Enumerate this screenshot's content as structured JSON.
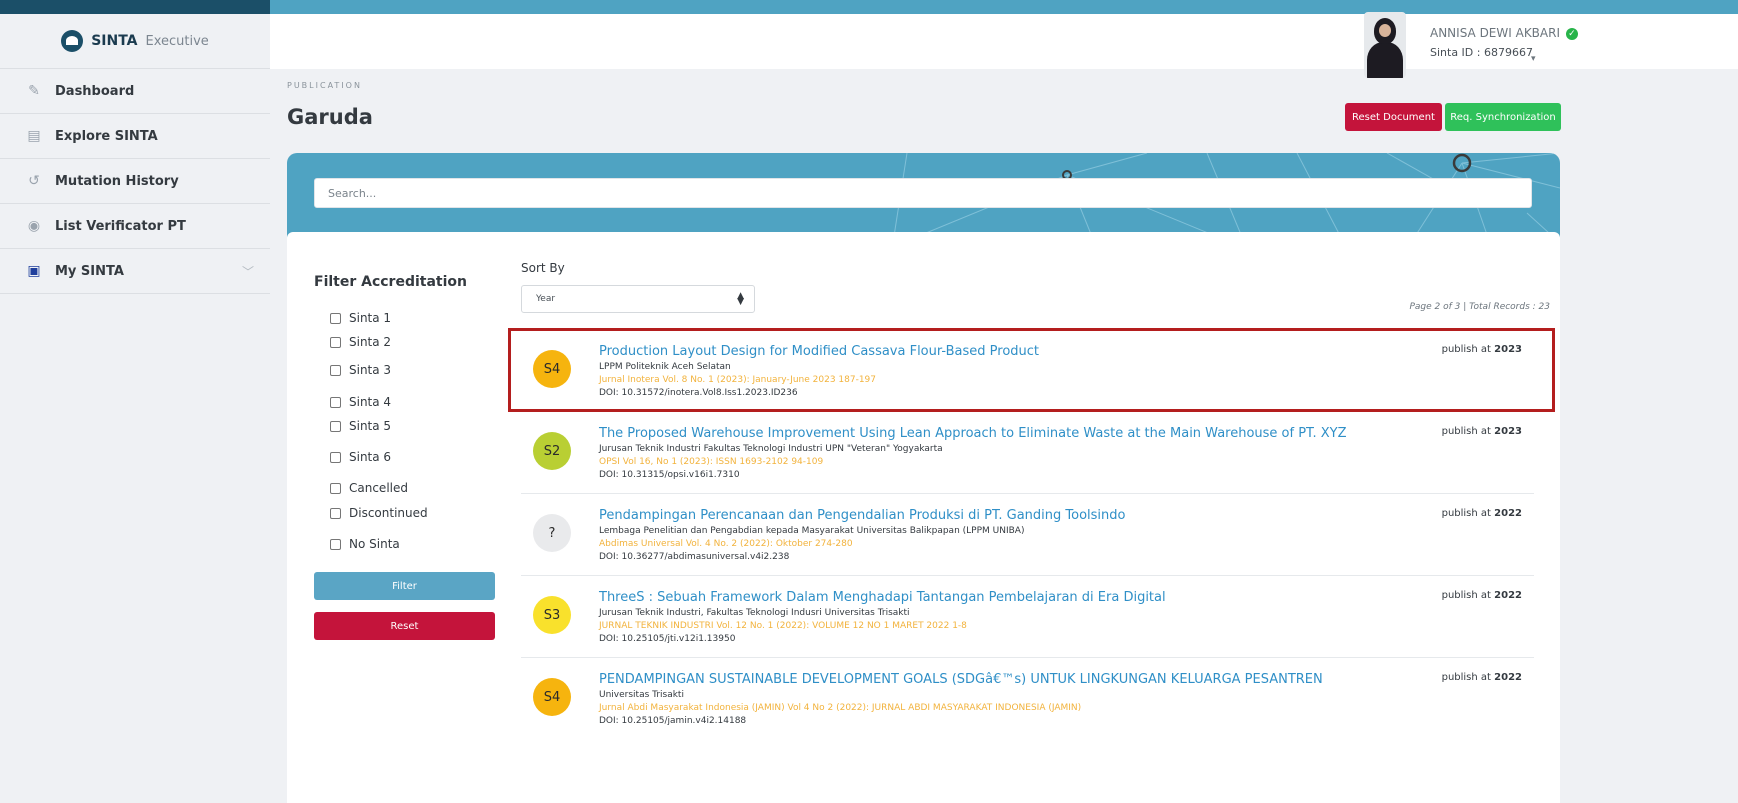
{
  "brand": {
    "name": "SINTA",
    "sub": "Executive"
  },
  "sidebar": {
    "items": [
      {
        "label": "Dashboard",
        "icon": "pencil-icon"
      },
      {
        "label": "Explore SINTA",
        "icon": "document-icon"
      },
      {
        "label": "Mutation History",
        "icon": "history-icon"
      },
      {
        "label": "List Verificator PT",
        "icon": "user-circle-icon"
      },
      {
        "label": "My SINTA",
        "icon": "id-card-icon"
      }
    ]
  },
  "user": {
    "name": "ANNISA DEWI AKBARI",
    "sinta_id": "Sinta ID : 6879667"
  },
  "page": {
    "section": "PUBLICATION",
    "title": "Garuda",
    "reset_document": "Reset Document",
    "req_sync": "Req. Synchronization"
  },
  "search": {
    "placeholder": "Search..."
  },
  "filter": {
    "title": "Filter Accreditation",
    "options": [
      "Sinta 1",
      "Sinta 2",
      "Sinta 3",
      "Sinta 4",
      "Sinta 5",
      "Sinta 6",
      "Cancelled",
      "Discontinued",
      "No Sinta"
    ],
    "filter_label": "Filter",
    "reset_label": "Reset"
  },
  "sort": {
    "label": "Sort By",
    "value": "Year"
  },
  "page_info": "Page 2 of 3 | Total Records : 23",
  "publications": [
    {
      "badge": "S4",
      "badge_color": "#f6b40e",
      "title": "Production Layout Design for Modified Cassava Flour-Based Product",
      "institution": "LPPM Politeknik Aceh Selatan",
      "journal": "Jurnal Inotera Vol. 8 No. 1 (2023): January-June 2023 187-197",
      "doi": "DOI: 10.31572/inotera.Vol8.Iss1.2023.ID236",
      "publish_prefix": "publish at",
      "year": "2023"
    },
    {
      "badge": "S2",
      "badge_color": "#b9cf33",
      "title": "The Proposed Warehouse Improvement Using Lean Approach to Eliminate Waste at the Main Warehouse of PT. XYZ",
      "institution": "Jurusan Teknik Industri Fakultas Teknologi Industri UPN \"Veteran\" Yogyakarta",
      "journal": "OPSI Vol 16, No 1 (2023): ISSN 1693-2102 94-109",
      "doi": "DOI: 10.31315/opsi.v16i1.7310",
      "publish_prefix": "publish at",
      "year": "2023"
    },
    {
      "badge": "?",
      "badge_color": "#e9eaec",
      "title": "Pendampingan Perencanaan dan Pengendalian Produksi di PT. Ganding Toolsindo",
      "institution": "Lembaga Penelitian dan Pengabdian kepada Masyarakat Universitas Balikpapan (LPPM UNIBA)",
      "journal": "Abdimas Universal Vol. 4 No. 2 (2022): Oktober 274-280",
      "doi": "DOI: 10.36277/abdimasuniversal.v4i2.238",
      "publish_prefix": "publish at",
      "year": "2022"
    },
    {
      "badge": "S3",
      "badge_color": "#f9e12c",
      "title": "ThreeS : Sebuah Framework Dalam Menghadapi Tantangan Pembelajaran di Era Digital",
      "institution": "Jurusan Teknik Industri, Fakultas Teknologi Indusri Universitas Trisakti",
      "journal": "JURNAL TEKNIK INDUSTRI Vol. 12 No. 1 (2022): VOLUME 12 NO 1 MARET 2022 1-8",
      "doi": "DOI: 10.25105/jti.v12i1.13950",
      "publish_prefix": "publish at",
      "year": "2022"
    },
    {
      "badge": "S4",
      "badge_color": "#f6b40e",
      "title": "PENDAMPINGAN SUSTAINABLE DEVELOPMENT GOALS (SDGâ€™s) UNTUK LINGKUNGAN KELUARGA PESANTREN",
      "institution": "Universitas Trisakti",
      "journal": "Jurnal Abdi Masyarakat Indonesia (JAMIN) Vol 4 No 2 (2022): JURNAL ABDI MASYARAKAT INDONESIA (JAMIN)",
      "doi": "DOI: 10.25105/jamin.v4i2.14188",
      "publish_prefix": "publish at",
      "year": "2022"
    }
  ]
}
